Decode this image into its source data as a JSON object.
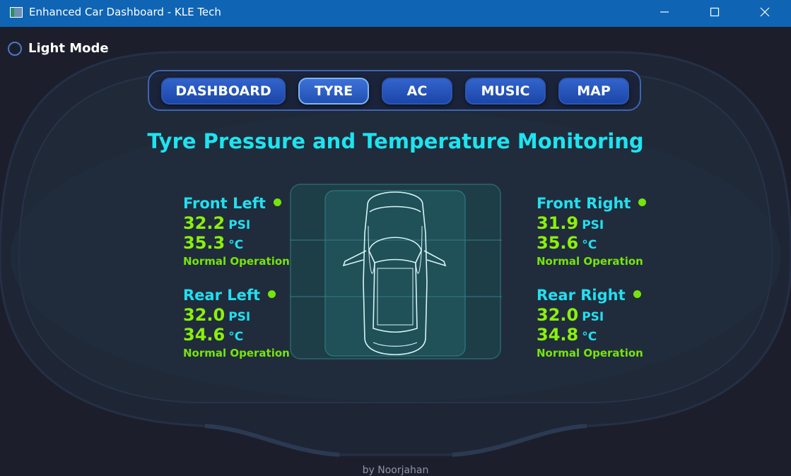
{
  "window": {
    "title": "Enhanced Car Dashboard - KLE Tech"
  },
  "mode_toggle": {
    "label": "Light Mode",
    "checked": false
  },
  "nav": {
    "buttons": [
      "DASHBOARD",
      "TYRE",
      "AC",
      "MUSIC",
      "MAP"
    ],
    "active": "TYRE"
  },
  "page_title": "Tyre Pressure and Temperature Monitoring",
  "tyres": {
    "front_left": {
      "name": "Front Left",
      "pressure": "32.2",
      "pressure_unit": "PSI",
      "temperature": "35.3",
      "temperature_unit": "°C",
      "status": "Normal Operation"
    },
    "front_right": {
      "name": "Front Right",
      "pressure": "31.9",
      "pressure_unit": "PSI",
      "temperature": "35.6",
      "temperature_unit": "°C",
      "status": "Normal Operation"
    },
    "rear_left": {
      "name": "Rear Left",
      "pressure": "32.0",
      "pressure_unit": "PSI",
      "temperature": "34.6",
      "temperature_unit": "°C",
      "status": "Normal Operation"
    },
    "rear_right": {
      "name": "Rear Right",
      "pressure": "32.0",
      "pressure_unit": "PSI",
      "temperature": "34.8",
      "temperature_unit": "°C",
      "status": "Normal Operation"
    }
  },
  "footer": "by Noorjahan",
  "colors": {
    "titlebar": "#0f64b4",
    "background": "#1c1f2b",
    "heading": "#1de4f0",
    "value": "#8af00c",
    "status_ok": "#76e40c",
    "button": "#2a58c0"
  },
  "icons": {
    "minimize": "minimize-icon",
    "maximize": "maximize-icon",
    "close": "close-icon",
    "car": "car-top-view-icon"
  }
}
